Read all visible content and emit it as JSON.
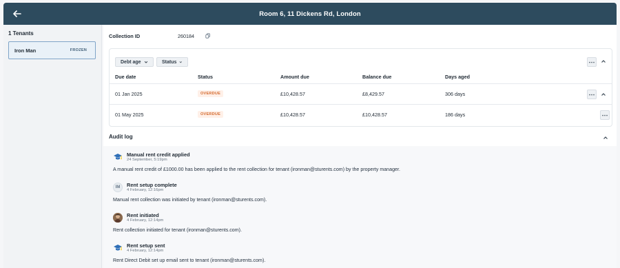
{
  "header": {
    "title": "Room 6, 11 Dickens Rd, London"
  },
  "sidebar": {
    "title": "1 Tenants",
    "tenant": {
      "name": "Iron Man",
      "status": "FROZEN"
    }
  },
  "collection": {
    "label": "Collection ID",
    "value": "260184"
  },
  "filters": {
    "debt_age": "Debt age",
    "status": "Status"
  },
  "table": {
    "headers": [
      "Due date",
      "Status",
      "Amount due",
      "Balance due",
      "Days aged"
    ],
    "rows": [
      {
        "due_date": "01 Jan 2025",
        "status": "OVERDUE",
        "amount_due": "£10,428.57",
        "balance_due": "£8,429.57",
        "days_aged": "306 days"
      },
      {
        "due_date": "01 May 2025",
        "status": "OVERDUE",
        "amount_due": "£10,428.57",
        "balance_due": "£10,428.57",
        "days_aged": "186 days"
      }
    ]
  },
  "audit": {
    "title": "Audit log",
    "entries": [
      {
        "title": "Manual rent credit applied",
        "time": "24 September, 5:19pm",
        "description": "A manual rent credit of £1000.00 has been applied to the rent collection for tenant (ironman@sturents.com) by the property manager.",
        "icon": "mortarboard-icon"
      },
      {
        "title": "Rent setup complete",
        "time": "4 February, 12:16pm",
        "description": "Manual rent collection was initiated by tenant (ironman@sturents.com).",
        "icon": "user-initials-avatar",
        "avatar_text": "IM"
      },
      {
        "title": "Rent initiated",
        "time": "4 February, 12:14pm",
        "description": "Rent collection initiated for tenant (ironman@sturents.com).",
        "icon": "profile-photo-avatar"
      },
      {
        "title": "Rent setup sent",
        "time": "4 February, 12:14pm",
        "description": "Rent Direct Debit set up email sent to tenant (ironman@sturents.com).",
        "icon": "mortarboard-icon"
      }
    ]
  },
  "colors": {
    "header_bg": "#2d4b5e",
    "selected_tenant_bg": "#e9f1f8",
    "selected_tenant_border": "#7fa4c8",
    "overdue_bg": "#fff0e8",
    "overdue_text": "#d46b2f",
    "mortarboard_blue": "#2f6fb7",
    "mortarboard_accent": "#f1c40f"
  }
}
